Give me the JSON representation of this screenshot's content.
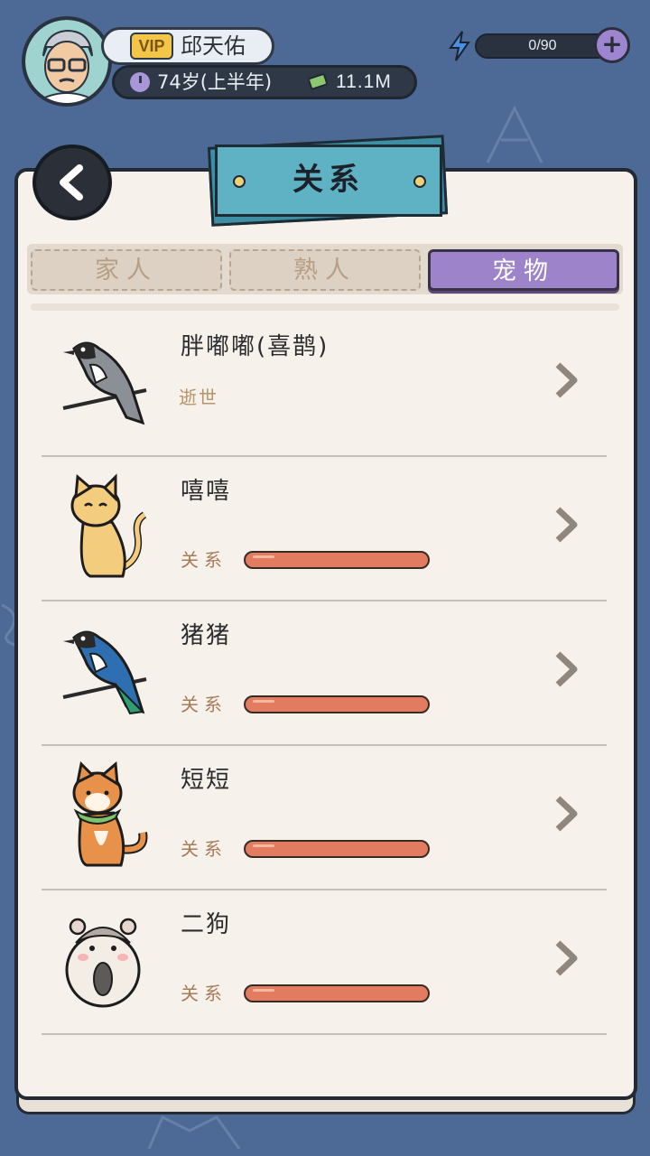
{
  "player": {
    "vip_label": "VIP",
    "name": "邱天佑",
    "age": "74岁(上半年)",
    "money": "11.1M"
  },
  "energy": {
    "text": "0/90",
    "plus": "+"
  },
  "title": "关系",
  "tabs": [
    {
      "label": "家人",
      "active": false
    },
    {
      "label": "熟人",
      "active": false
    },
    {
      "label": "宠物",
      "active": true
    }
  ],
  "pets": [
    {
      "name": "胖嘟嘟(喜鹊)",
      "status": "逝世",
      "icon": "magpie-gray-icon"
    },
    {
      "name": "嘻嘻",
      "relation_label": "关系",
      "relation_level": 1.0,
      "icon": "cat-icon"
    },
    {
      "name": "猪猪",
      "relation_label": "关系",
      "relation_level": 1.0,
      "icon": "magpie-blue-icon"
    },
    {
      "name": "短短",
      "relation_label": "关系",
      "relation_level": 1.0,
      "icon": "shiba-dog-icon"
    },
    {
      "name": "二狗",
      "relation_label": "关系",
      "relation_level": 1.0,
      "icon": "hamster-icon"
    }
  ],
  "colors": {
    "background": "#4d6996",
    "active_tab": "#9d83c9",
    "relation_bar": "#e27c60",
    "title_card": "#5fb2c4"
  }
}
